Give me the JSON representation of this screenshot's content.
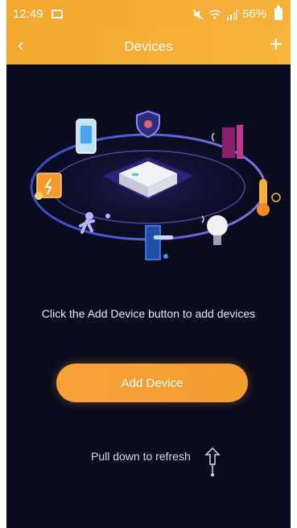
{
  "status_bar": {
    "time": "12:49",
    "battery_percent": "56%",
    "icons": [
      "gallery-icon",
      "mute-icon",
      "wifi-icon",
      "signal-icon",
      "battery-icon"
    ]
  },
  "header": {
    "title": "Devices",
    "back_icon": "‹",
    "add_icon": "+"
  },
  "main": {
    "hint_text": "Click the Add Device button to add devices",
    "add_button_label": "Add Device",
    "refresh_text": "Pull down to refresh"
  },
  "colors": {
    "accent": "#f4a82f",
    "background": "#0a0b1e"
  }
}
